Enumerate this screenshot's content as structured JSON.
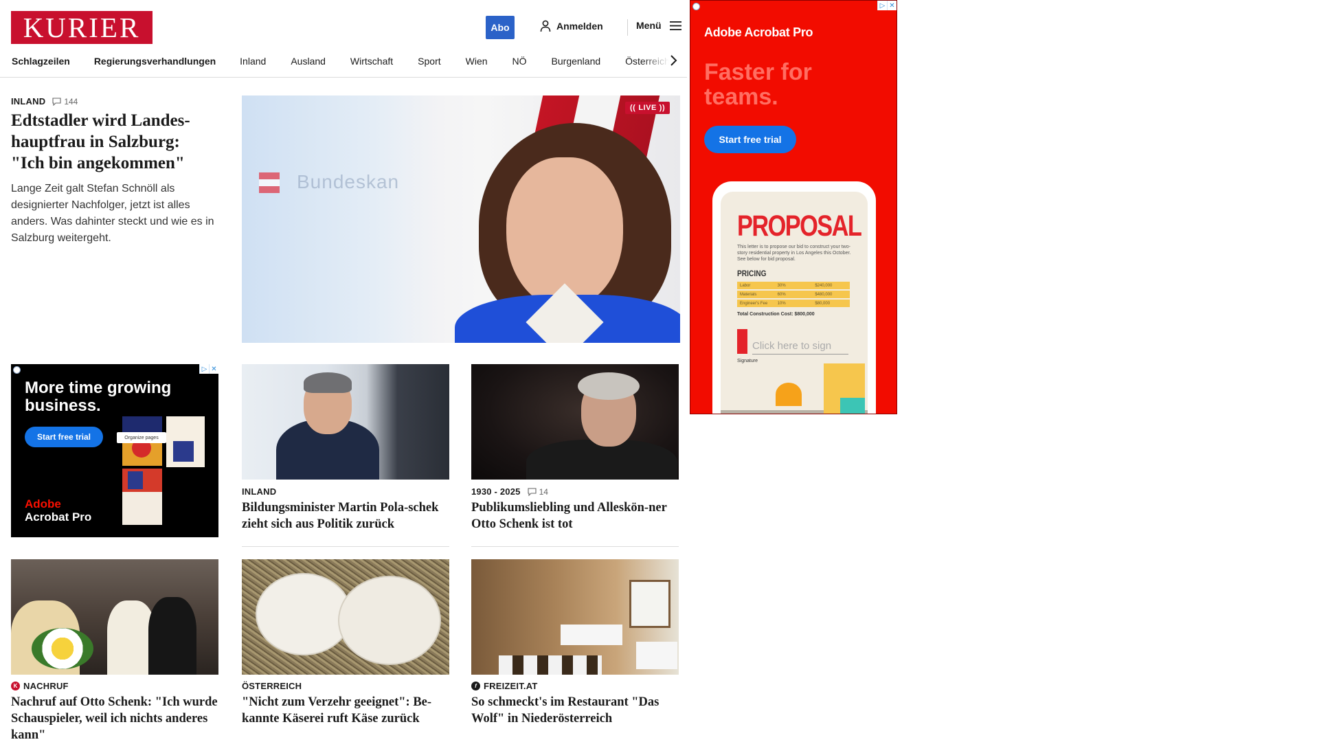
{
  "header": {
    "logo": "KURIER",
    "abo_label": "Abo",
    "login_label": "Anmelden",
    "menu_label": "Menü"
  },
  "nav": {
    "items": [
      "Schlagzeilen",
      "Regierungsverhandlungen",
      "Inland",
      "Ausland",
      "Wirtschaft",
      "Sport",
      "Wien",
      "NÖ",
      "Burgenland",
      "Österreich"
    ]
  },
  "lead": {
    "kicker": "INLAND",
    "comments": "144",
    "title": "Edtstadler wird Landes-hauptfrau in Salzburg: \"Ich bin angekommen\"",
    "teaser": "Lange Zeit galt Stefan Schnöll als designierter Nachfolger, jetzt ist alles anders. Was dahinter steckt und wie es in Salzburg weitergeht.",
    "live_badge": "LIVE",
    "image_text": "Bundeskan"
  },
  "ad_small": {
    "headline": "More time growing business.",
    "cta": "Start free trial",
    "organize": "Organize pages",
    "brand_line1": "Adobe",
    "brand_line2": "Acrobat Pro"
  },
  "ad_big": {
    "brand": "Adobe Acrobat Pro",
    "headline": "Faster for teams.",
    "cta": "Start free trial",
    "doc_title": "PROPOSAL",
    "doc_letter": "This letter is to propose our bid to construct your two-story residential property in Los Angeles this October. See below for bid proposal.",
    "pricing_label": "PRICING",
    "pricing_rows": [
      {
        "item": "Labor",
        "pct": "30%",
        "amount": "$240,000"
      },
      {
        "item": "Materials",
        "pct": "60%",
        "amount": "$480,000"
      },
      {
        "item": "Engineer's Fee",
        "pct": "10%",
        "amount": "$80,000"
      }
    ],
    "total": "Total Construction Cost: $800,000",
    "sign_prompt": "Click here to sign",
    "signature_label": "Signature"
  },
  "cards": [
    {
      "kicker": "INLAND",
      "comments": "",
      "title": "Bildungsminister Martin Pola-schek zieht sich aus Politik zurück"
    },
    {
      "kicker": "1930 - 2025",
      "comments": "14",
      "title": "Publikumsliebling und Alleskön-ner Otto Schenk ist tot"
    },
    {
      "kicker": "NACHRUF",
      "comments": "",
      "title": "Nachruf auf Otto Schenk: \"Ich wurde Schauspieler, weil ich nichts anderes kann\""
    },
    {
      "kicker": "ÖSTERREICH",
      "comments": "",
      "title": "\"Nicht zum Verzehr geeignet\": Be-kannte Käserei ruft Käse zurück"
    },
    {
      "kicker": "FREIZEIT.AT",
      "comments": "",
      "title": "So schmeckt's im Restaurant \"Das Wolf\" in Niederösterreich"
    }
  ],
  "colors": {
    "brand_red": "#c8102e",
    "abo_blue": "#2b62c8",
    "adobe_blue": "#1473e6",
    "adobe_red": "#f20c00"
  }
}
